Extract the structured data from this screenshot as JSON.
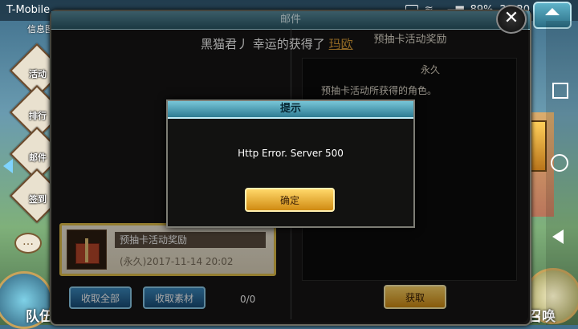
{
  "statusbar": {
    "carrier": "T-Mobile",
    "battery": "89%",
    "time": "20:20"
  },
  "sidebar": {
    "info": "信息图",
    "items": [
      "活动",
      "排行",
      "邮件",
      "签到"
    ],
    "team": "队伍"
  },
  "right": {
    "summon": "召唤"
  },
  "mail": {
    "title": "邮件",
    "announcement": {
      "user": "黑猫君丿",
      "text": "幸运的获得了",
      "character": "玛欧"
    },
    "item": {
      "title": "预抽卡活动奖励",
      "date": "(永久)2017-11-14  20:02"
    },
    "buttons": {
      "collect_all": "收取全部",
      "collect_material": "收取素材",
      "count": "0/0"
    },
    "detail": {
      "title": "预抽卡活动奖励",
      "period": "永久",
      "description": "预抽卡活动所获得的角色。",
      "obtain": "获取"
    }
  },
  "dialog": {
    "title": "提示",
    "message": "Http Error. Server 500",
    "ok": "确定"
  },
  "colors": {
    "accent_gold": "#e0a23a",
    "dialog_header": "#4fa3ba",
    "button_blue": "#2b6d9d"
  }
}
